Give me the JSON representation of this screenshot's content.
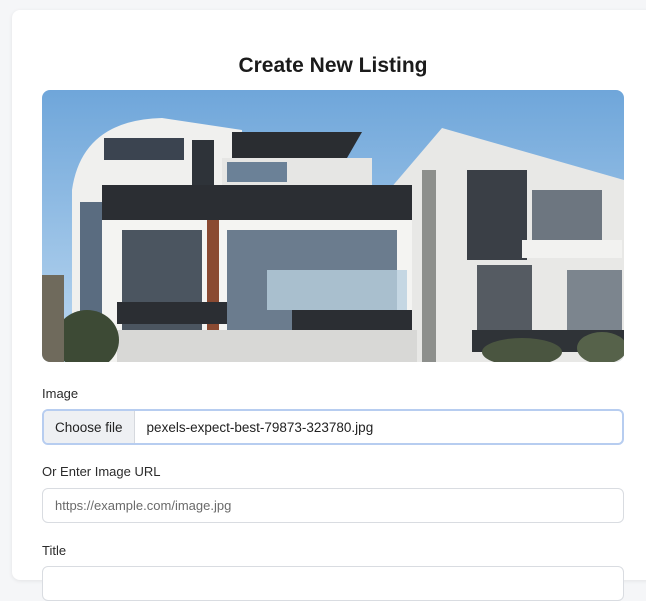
{
  "form": {
    "title": "Create New Listing",
    "image_label": "Image",
    "file_button": "Choose file",
    "file_name": "pexels-expect-best-79873-323780.jpg",
    "url_label": "Or Enter Image URL",
    "url_placeholder": "https://example.com/image.jpg",
    "title_label": "Title"
  }
}
